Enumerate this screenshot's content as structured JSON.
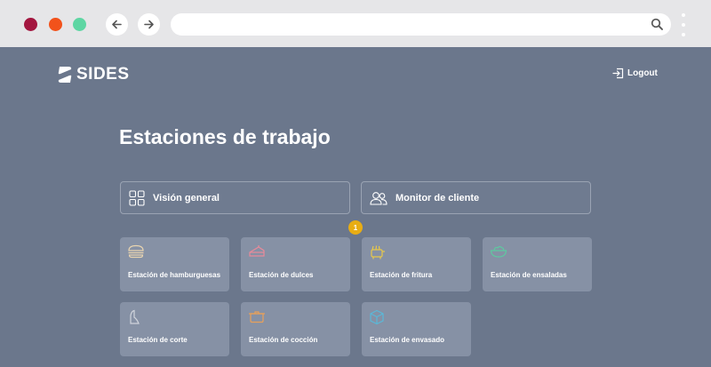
{
  "app": {
    "brand": "SIDES",
    "logout_label": "Logout",
    "page_title": "Estaciones de trabajo"
  },
  "overview": {
    "general_label": "Visión general",
    "monitor_label": "Monitor de cliente"
  },
  "badge": "1",
  "stations": [
    {
      "label": "Estación de hamburguesas",
      "icon": "burger-icon",
      "color": "#e8d4b0"
    },
    {
      "label": "Estación de dulces",
      "icon": "cake-icon",
      "color": "#e88a9a"
    },
    {
      "label": "Estación de fritura",
      "icon": "fryer-icon",
      "color": "#e8c84a"
    },
    {
      "label": "Estación de ensaladas",
      "icon": "salad-bowl-icon",
      "color": "#5ec9a0"
    },
    {
      "label": "Estación de corte",
      "icon": "knife-icon",
      "color": "#d0d4dc"
    },
    {
      "label": "Estación de cocción",
      "icon": "pot-icon",
      "color": "#e8a05a"
    },
    {
      "label": "Estación de envasado",
      "icon": "box-icon",
      "color": "#5ab8d8"
    }
  ],
  "colors": {
    "background": "#6b778c",
    "tile": "#8691a5",
    "badge": "#e8ad14",
    "close_dot": "#a3163f",
    "minimize_dot": "#f2521b",
    "maximize_dot": "#5ed6a3"
  }
}
